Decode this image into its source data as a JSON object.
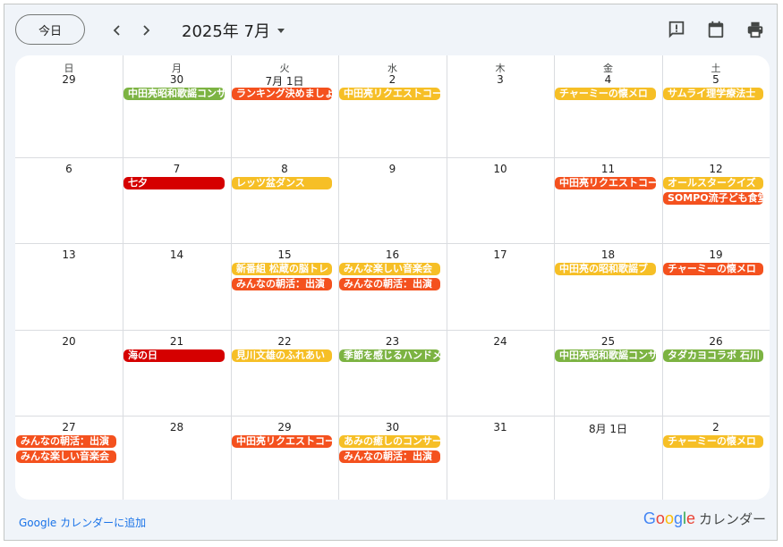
{
  "toolbar": {
    "today_label": "今日",
    "month_title": "2025年 7月"
  },
  "icons": [
    "chevron-left-icon",
    "chevron-right-icon",
    "dropdown-arrow-icon",
    "feedback-icon",
    "calendar-icon",
    "print-icon"
  ],
  "weekdays": [
    "日",
    "月",
    "火",
    "水",
    "木",
    "金",
    "土"
  ],
  "weeks": [
    [
      "29",
      "30",
      "7月 1日",
      "2",
      "3",
      "4",
      "5"
    ],
    [
      "6",
      "7",
      "8",
      "9",
      "10",
      "11",
      "12"
    ],
    [
      "13",
      "14",
      "15",
      "16",
      "17",
      "18",
      "19"
    ],
    [
      "20",
      "21",
      "22",
      "23",
      "24",
      "25",
      "26"
    ],
    [
      "27",
      "28",
      "29",
      "30",
      "31",
      "8月 1日",
      "2"
    ]
  ],
  "colors": {
    "green": "#7cb342",
    "orange": "#f4511e",
    "yellow": "#f6bf26",
    "red": "#d50000"
  },
  "events": [
    {
      "week": 0,
      "day": 1,
      "slot": 0,
      "color": "green",
      "title": "中田亮昭和歌謡コンサート"
    },
    {
      "week": 0,
      "day": 2,
      "slot": 0,
      "color": "orange",
      "title": "ランキング決めましょう"
    },
    {
      "week": 0,
      "day": 3,
      "slot": 0,
      "color": "yellow",
      "title": "中田亮リクエストコーナー"
    },
    {
      "week": 0,
      "day": 5,
      "slot": 0,
      "color": "yellow",
      "title": "チャーミーの懐メロ"
    },
    {
      "week": 0,
      "day": 6,
      "slot": 0,
      "color": "yellow",
      "title": "サムライ理学療法士"
    },
    {
      "week": 1,
      "day": 1,
      "slot": 0,
      "color": "red",
      "title": "七夕"
    },
    {
      "week": 1,
      "day": 2,
      "slot": 0,
      "color": "yellow",
      "title": "レッツ盆ダンス"
    },
    {
      "week": 1,
      "day": 5,
      "slot": 0,
      "color": "orange",
      "title": "中田亮リクエストコーナー"
    },
    {
      "week": 1,
      "day": 6,
      "slot": 0,
      "color": "yellow",
      "title": "オールスタークイズ"
    },
    {
      "week": 1,
      "day": 6,
      "slot": 1,
      "color": "orange",
      "title": "SOMPO流子ども食堂"
    },
    {
      "week": 2,
      "day": 2,
      "slot": 0,
      "color": "yellow",
      "title": "新番組 松蔵の脳トレ"
    },
    {
      "week": 2,
      "day": 2,
      "slot": 1,
      "color": "orange",
      "title": "みんなの朝活：出演"
    },
    {
      "week": 2,
      "day": 3,
      "slot": 0,
      "color": "yellow",
      "title": "みんな楽しい音楽会"
    },
    {
      "week": 2,
      "day": 3,
      "slot": 1,
      "color": "orange",
      "title": "みんなの朝活：出演"
    },
    {
      "week": 2,
      "day": 5,
      "slot": 0,
      "color": "yellow",
      "title": "中田亮の昭和歌謡ブ"
    },
    {
      "week": 2,
      "day": 6,
      "slot": 0,
      "color": "orange",
      "title": "チャーミーの懐メロ"
    },
    {
      "week": 3,
      "day": 1,
      "slot": 0,
      "color": "red",
      "title": "海の日"
    },
    {
      "week": 3,
      "day": 2,
      "slot": 0,
      "color": "yellow",
      "title": "見川文雄のふれあい"
    },
    {
      "week": 3,
      "day": 3,
      "slot": 0,
      "color": "green",
      "title": "季節を感じるハンドメイド"
    },
    {
      "week": 3,
      "day": 5,
      "slot": 0,
      "color": "green",
      "title": "中田亮昭和歌謡コンサート"
    },
    {
      "week": 3,
      "day": 6,
      "slot": 0,
      "color": "green",
      "title": "タダカヨコラボ 石川"
    },
    {
      "week": 4,
      "day": 0,
      "slot": 0,
      "color": "orange",
      "title": "みんなの朝活：出演"
    },
    {
      "week": 4,
      "day": 0,
      "slot": 1,
      "color": "orange",
      "title": "みんな楽しい音楽会"
    },
    {
      "week": 4,
      "day": 2,
      "slot": 0,
      "color": "orange",
      "title": "中田亮リクエストコーナー"
    },
    {
      "week": 4,
      "day": 3,
      "slot": 0,
      "color": "yellow",
      "title": "あみの癒しのコンサート"
    },
    {
      "week": 4,
      "day": 3,
      "slot": 1,
      "color": "orange",
      "title": "みんなの朝活：出演"
    },
    {
      "week": 4,
      "day": 6,
      "slot": 0,
      "color": "yellow",
      "title": "チャーミーの懐メロ"
    }
  ],
  "footer": {
    "add_link": "Google カレンダーに追加",
    "brand_google": "Google",
    "brand_calendar": "カレンダー"
  }
}
